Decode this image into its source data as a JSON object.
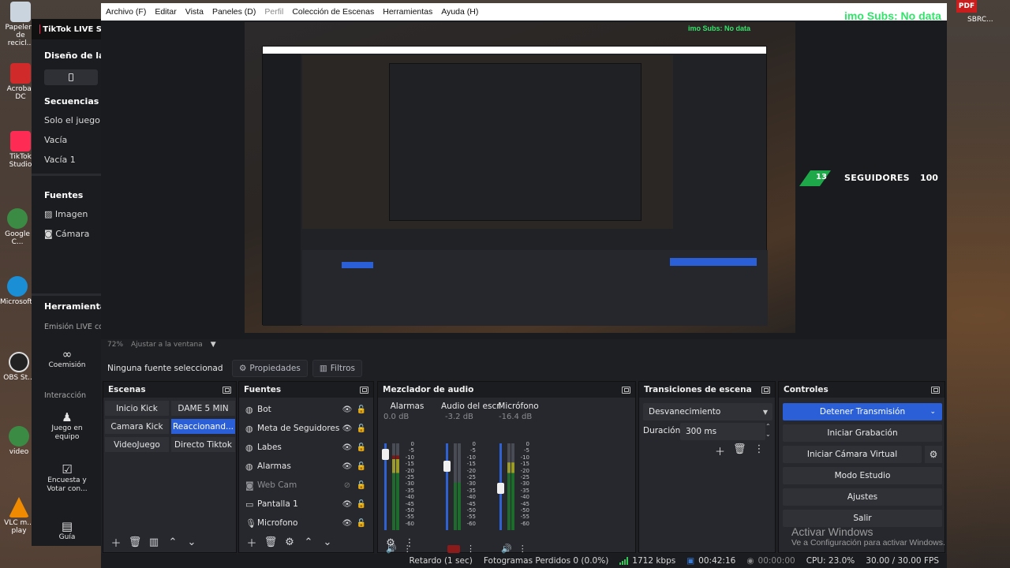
{
  "desktop": {
    "icons": [
      {
        "label": "Papelera de recicl..."
      },
      {
        "label": "Acrobat DC"
      },
      {
        "label": "TikTok Studio"
      },
      {
        "label": "Google C..."
      },
      {
        "label": "Microsoft..."
      },
      {
        "label": "OBS St..."
      },
      {
        "label": "video"
      },
      {
        "label": "VLC m... play"
      }
    ],
    "right_label": "SBRC...",
    "pdf_label": "PDF"
  },
  "tiktok_panel": {
    "title": "TikTok LIVE S",
    "design_section": "Diseño de la s",
    "sequences_section": "Secuencias",
    "sequences": [
      "Solo el juego",
      "Vacía",
      "Vacía 1"
    ],
    "sources_section": "Fuentes",
    "sources": [
      "Imagen",
      "Cámara"
    ],
    "tools_section": "Herramientas",
    "tools_sub": "Emisión LIVE co",
    "tools": [
      {
        "label": "Coemisión",
        "icon": "link-icon"
      },
      {
        "label": "Interacción",
        "icon": ""
      },
      {
        "label": "Juego en equipo",
        "icon": "person-icon"
      },
      {
        "label": "Encuesta y Votar con...",
        "icon": "poll-icon"
      },
      {
        "label": "Guía",
        "icon": "book-icon"
      }
    ]
  },
  "menubar": {
    "items": [
      "Archivo (F)",
      "Editar",
      "Vista",
      "Paneles (D)",
      "Perfil",
      "Colección de Escenas",
      "Herramientas",
      "Ayuda (H)"
    ]
  },
  "preview": {
    "subs_text": "imo Subs: No data",
    "follower_count": "13",
    "follower_label": "SEGUIDORES",
    "follower_goal": "100",
    "zoom": "72%",
    "fit_label": "Ajustar a la ventana"
  },
  "source_toolbar": {
    "no_selection": "Ninguna fuente seleccionad",
    "properties": "Propiedades",
    "filters": "Filtros"
  },
  "scenes": {
    "title": "Escenas",
    "items": [
      {
        "label": "Inicio Kick",
        "active": false
      },
      {
        "label": "DAME 5 MIN",
        "active": false
      },
      {
        "label": "Camara Kick",
        "active": false
      },
      {
        "label": "Reaccionand...",
        "active": true
      },
      {
        "label": "VideoJuego",
        "active": false
      },
      {
        "label": "Directo Tiktok",
        "active": false
      }
    ]
  },
  "sources": {
    "title": "Fuentes",
    "items": [
      {
        "label": "Bot",
        "icon": "globe-icon",
        "visible": true
      },
      {
        "label": "Meta de Seguidores",
        "icon": "globe-icon",
        "visible": true
      },
      {
        "label": "Labes",
        "icon": "globe-icon",
        "visible": true
      },
      {
        "label": "Alarmas",
        "icon": "globe-icon",
        "visible": true
      },
      {
        "label": "Web Cam",
        "icon": "camera-icon",
        "visible": false
      },
      {
        "label": "Pantalla 1",
        "icon": "monitor-icon",
        "visible": true
      },
      {
        "label": "Microfono",
        "icon": "mic-icon",
        "visible": true
      }
    ]
  },
  "mixer": {
    "title": "Mezclador de audio",
    "channels": [
      {
        "name": "Alarmas",
        "db": "0.0 dB",
        "level": 0.86,
        "fader": 0.93,
        "muted": false
      },
      {
        "name": "Audio del escrito",
        "db": "-3.2 dB",
        "level": 0.55,
        "fader": 0.78,
        "muted": true
      },
      {
        "name": "Micrófono",
        "db": "-16.4 dB",
        "level": 0.78,
        "fader": 0.5,
        "muted": false
      }
    ],
    "ticks": [
      "0",
      "-5",
      "-10",
      "-15",
      "-20",
      "-25",
      "-30",
      "-35",
      "-40",
      "-45",
      "-50",
      "-55",
      "-60"
    ]
  },
  "transitions": {
    "title": "Transiciones de escena",
    "selected": "Desvanecimiento",
    "duration_label": "Duración",
    "duration_value": "300 ms"
  },
  "controls": {
    "title": "Controles",
    "stop_stream": "Detener Transmisión",
    "start_recording": "Iniciar Grabación",
    "start_virtual_cam": "Iniciar Cámara Virtual",
    "studio_mode": "Modo Estudio",
    "settings": "Ajustes",
    "exit": "Salir"
  },
  "status": {
    "delay": "Retardo (1 sec)",
    "dropped": "Fotogramas Perdidos 0 (0.0%)",
    "bitrate": "1712 kbps",
    "stream_time": "00:42:16",
    "rec_time": "00:00:00",
    "cpu": "CPU: 23.0%",
    "fps": "30.00 / 30.00 FPS"
  },
  "watermark": {
    "line1": "Activar Windows",
    "line2": "Ve a Configuración para activar Windows."
  },
  "colors": {
    "accent": "#2a5fd8",
    "green": "#32e56a",
    "muted": "#8b1a1a"
  }
}
